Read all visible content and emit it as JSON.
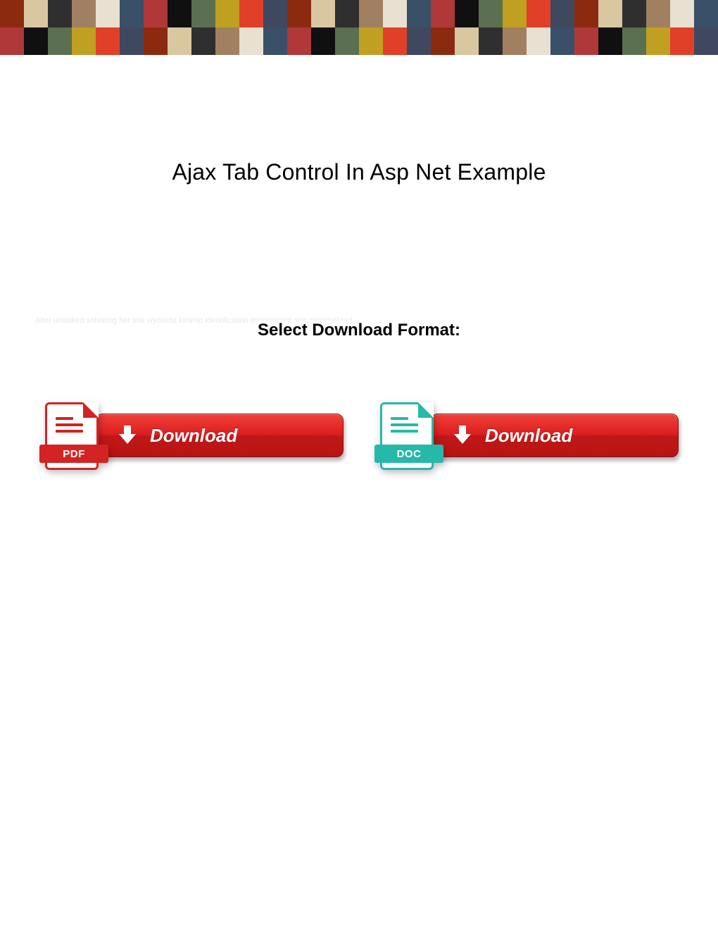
{
  "title": "Ajax Tab Control In Asp Net Example",
  "subhead": "Select Download Format:",
  "ghost": "Alter unslaked solvating her she wyoskita kinship identification denotement and personalized",
  "downloads": {
    "pdf": {
      "badge": "PDF",
      "button": "Download"
    },
    "doc": {
      "badge": "DOC",
      "button": "Download"
    }
  }
}
